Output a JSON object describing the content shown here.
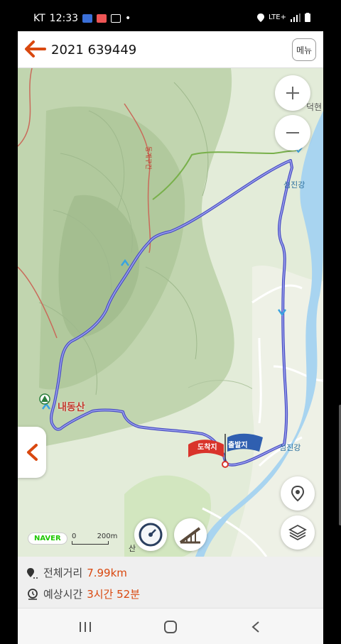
{
  "status_bar": {
    "carrier": "KT",
    "time": "12:33",
    "network": "LTE+",
    "dot": "•"
  },
  "header": {
    "title": "2021 639449",
    "menu_label": "메뉴"
  },
  "map": {
    "labels": {
      "river_top": "덕현",
      "river_1": "섬진강",
      "river_2": "섬진강",
      "mountain": "내동산",
      "road": "동계구간",
      "bottom_place": "산",
      "scale": "200m",
      "scale_zero": "0",
      "brand": "NAVER"
    },
    "markers": {
      "arrival": "도착지",
      "departure": "출발지"
    },
    "colors": {
      "route": "#4a4fc4",
      "arrival": "#d9342b",
      "departure": "#2f5fb0",
      "trail_green": "#78b04a",
      "contour_red": "#c96a5a",
      "river": "#a8d4f0"
    }
  },
  "summary": {
    "distance_label": "전체거리",
    "distance_value": "7.99km",
    "time_label": "예상시간",
    "time_value": "3시간 52분"
  }
}
